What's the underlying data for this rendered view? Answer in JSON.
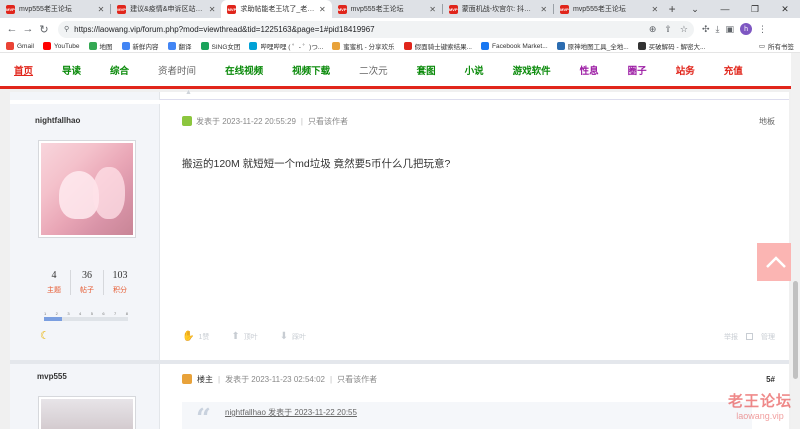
{
  "browser": {
    "tabs": [
      {
        "label": "mvp555老王论坛",
        "active": false
      },
      {
        "label": "建议&疫情&申诉区站务区_老王",
        "active": false
      },
      {
        "label": "求助帖能老王坑了_老王论坛",
        "active": true
      },
      {
        "label": "mvp555老王论坛",
        "active": false
      },
      {
        "label": "蒙面机战-坎宫尔: 抖音风靡播",
        "active": false
      },
      {
        "label": "mvp555老王论坛",
        "active": false
      }
    ],
    "url": "https://laowang.vip/forum.php?mod=viewthread&tid=1225163&page=1#pid18419967",
    "profile_initial": "h"
  },
  "bookmarks": [
    {
      "label": "Gmail",
      "color": "#ea4335"
    },
    {
      "label": "YouTube",
      "color": "#ff0000"
    },
    {
      "label": "地图",
      "color": "#34a853"
    },
    {
      "label": "新鲜内容",
      "color": "#4285f4"
    },
    {
      "label": "翻译",
      "color": "#4285f4"
    },
    {
      "label": "SING女团",
      "color": "#1aa35b"
    },
    {
      "label": "哔哩哔哩 ( ゜- ゜)つ...",
      "color": "#00a1d6"
    },
    {
      "label": "蜜蜜机 - 分享欢乐",
      "color": "#e8a23a"
    },
    {
      "label": "假面骑士键索结果...",
      "color": "#e0251b"
    },
    {
      "label": "Facebook Market...",
      "color": "#1877f2"
    },
    {
      "label": "原神地图工具_全地...",
      "color": "#2b6cb0"
    },
    {
      "label": "买破解码 - 解密大...",
      "color": "#333333"
    }
  ],
  "bookmarks_more": "所有书签",
  "sitenav": [
    {
      "label": "首页",
      "style": "home"
    },
    {
      "label": "导读",
      "style": "green"
    },
    {
      "label": "综合",
      "style": "green"
    },
    {
      "label": "资者时间",
      "style": "grey"
    },
    {
      "label": "在线视频",
      "style": "green"
    },
    {
      "label": "视频下载",
      "style": "green"
    },
    {
      "label": "二次元",
      "style": "grey"
    },
    {
      "label": "套图",
      "style": "green"
    },
    {
      "label": "小说",
      "style": "green"
    },
    {
      "label": "游戏软件",
      "style": "green"
    },
    {
      "label": "性息",
      "style": "purple"
    },
    {
      "label": "圈子",
      "style": "purple"
    },
    {
      "label": "站务",
      "style": "red"
    },
    {
      "label": "充值",
      "style": "red"
    }
  ],
  "post1": {
    "author": "nightfallhao",
    "stats": [
      {
        "value": "4",
        "label": "主题"
      },
      {
        "value": "36",
        "label": "帖子"
      },
      {
        "value": "103",
        "label": "积分"
      }
    ],
    "levels": [
      "1",
      "2",
      "3",
      "4",
      "5",
      "6",
      "7",
      "8"
    ],
    "level_progress": 0.22,
    "posted_at": "发表于 2023-11-22 20:55:29",
    "only_author": "只看该作者",
    "floor": "地板",
    "message": "搬运的120M 就短短一个md垃圾 竟然要5币什么几把玩意?",
    "footer": {
      "like": "1赞",
      "up": "顶叶",
      "down": "踩叶",
      "report": "举报",
      "manage": "管理"
    }
  },
  "post2": {
    "author": "mvp555",
    "role": "楼主",
    "posted_at": "发表于 2023-11-23 02:54:02",
    "only_author": "只看该作者",
    "floor": "5#",
    "quote": "nightfallhao 发表于 2023-11-22 20:55"
  },
  "watermark": {
    "line1": "老王论坛",
    "line2": "laowang.vip"
  },
  "colors": {
    "accent": "#e1251b",
    "nav_green": "#0a8a0a",
    "nav_purple": "#9b1aa3",
    "stat_label": "#e6582e"
  }
}
